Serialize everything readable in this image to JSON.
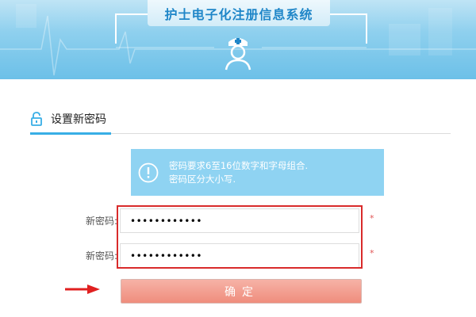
{
  "header": {
    "title": "护士电子化注册信息系统",
    "logo_icon": "nurse-avatar-icon",
    "background_color": "#8fd0ee",
    "title_color": "#1f86c8"
  },
  "section": {
    "icon": "lock-icon",
    "title": "设置新密码",
    "accent_color": "#38aee6"
  },
  "notice": {
    "icon": "info-icon",
    "lines": [
      "密码要求6至16位数字和字母组合.",
      "密码区分大小写."
    ],
    "background_color": "#8fd3f2"
  },
  "form": {
    "fields": [
      {
        "label": "新密码:",
        "value": "••••••••••••",
        "required_mark": "*"
      },
      {
        "label": "新密码:",
        "value": "••••••••••••",
        "required_mark": "*"
      }
    ],
    "highlight_color": "#d92b2b"
  },
  "submit": {
    "label": "确定",
    "color": "#ef8d7d"
  },
  "annotation": {
    "icon": "red-arrow-icon",
    "color": "#e02020"
  }
}
